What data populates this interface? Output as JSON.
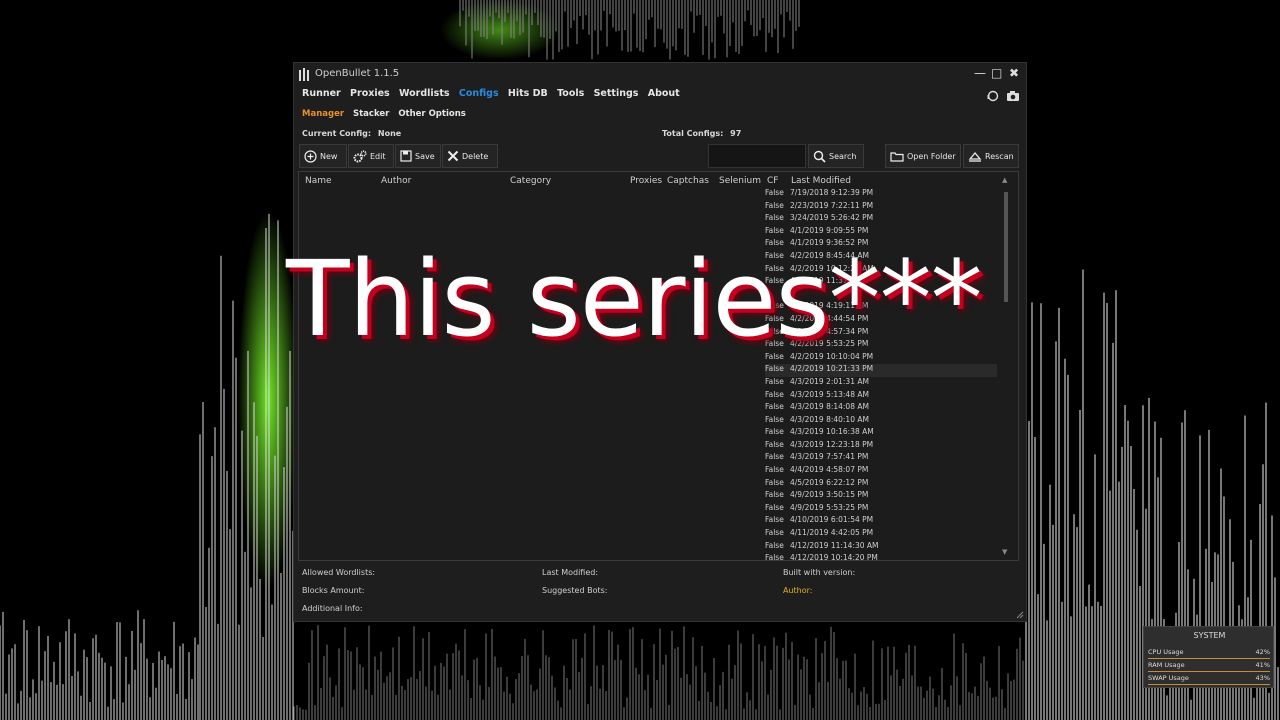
{
  "window": {
    "title": "OpenBullet 1.1.5",
    "minimize_icon": "minimize-icon",
    "maximize_icon": "maximize-icon",
    "close_icon": "close-icon"
  },
  "nav": {
    "items": [
      "Runner",
      "Proxies",
      "Wordlists",
      "Configs",
      "Hits DB",
      "Tools",
      "Settings",
      "About"
    ],
    "active": "Configs",
    "active_color": "#2a8be0"
  },
  "subnav": {
    "items": [
      "Manager",
      "Stacker",
      "Other Options"
    ],
    "active": "Manager",
    "active_color": "#e8902a"
  },
  "info": {
    "current_config_label": "Current Config:",
    "current_config_value": "None",
    "total_configs_label": "Total Configs:",
    "total_configs_value": "97"
  },
  "toolbar": {
    "new_label": "New",
    "edit_label": "Edit",
    "save_label": "Save",
    "delete_label": "Delete",
    "search_label": "Search",
    "open_folder_label": "Open Folder",
    "rescan_label": "Rescan"
  },
  "table": {
    "columns": [
      "Name",
      "Author",
      "Category",
      "Proxies",
      "Captchas",
      "Selenium",
      "CF",
      "Last Modified"
    ],
    "rows": [
      {
        "cf": "False",
        "last_modified": "7/19/2018 9:12:39 PM"
      },
      {
        "cf": "False",
        "last_modified": "2/23/2019 7:22:11 PM"
      },
      {
        "cf": "False",
        "last_modified": "3/24/2019 5:26:42 PM"
      },
      {
        "cf": "False",
        "last_modified": "4/1/2019 9:09:55 PM"
      },
      {
        "cf": "False",
        "last_modified": "4/1/2019 9:36:52 PM"
      },
      {
        "cf": "False",
        "last_modified": "4/2/2019 8:45:44 AM"
      },
      {
        "cf": "False",
        "last_modified": "4/2/2019 10:12:27 AM"
      },
      {
        "cf": "False",
        "last_modified": "4/2/2019 11:37:06"
      },
      {
        "cf": "",
        "last_modified": ""
      },
      {
        "cf": "False",
        "last_modified": "4/2/2019 4:19:11 PM"
      },
      {
        "cf": "False",
        "last_modified": "4/2/2019 4:44:54 PM"
      },
      {
        "cf": "False",
        "last_modified": "4/2/2019 4:57:34 PM"
      },
      {
        "cf": "False",
        "last_modified": "4/2/2019 5:53:25 PM"
      },
      {
        "cf": "False",
        "last_modified": "4/2/2019 10:10:04 PM"
      },
      {
        "cf": "False",
        "last_modified": "4/2/2019 10:21:33 PM"
      },
      {
        "cf": "False",
        "last_modified": "4/3/2019 2:01:31 AM"
      },
      {
        "cf": "False",
        "last_modified": "4/3/2019 5:13:48 AM"
      },
      {
        "cf": "False",
        "last_modified": "4/3/2019 8:14:08 AM"
      },
      {
        "cf": "False",
        "last_modified": "4/3/2019 8:40:10 AM"
      },
      {
        "cf": "False",
        "last_modified": "4/3/2019 10:16:38 AM"
      },
      {
        "cf": "False",
        "last_modified": "4/3/2019 12:23:18 PM"
      },
      {
        "cf": "False",
        "last_modified": "4/3/2019 7:57:41 PM"
      },
      {
        "cf": "False",
        "last_modified": "4/4/2019 4:58:07 PM"
      },
      {
        "cf": "False",
        "last_modified": "4/5/2019 6:22:12 PM"
      },
      {
        "cf": "False",
        "last_modified": "4/9/2019 3:50:15 PM"
      },
      {
        "cf": "False",
        "last_modified": "4/9/2019 5:53:25 PM"
      },
      {
        "cf": "False",
        "last_modified": "4/10/2019 6:01:54 PM"
      },
      {
        "cf": "False",
        "last_modified": "4/11/2019 4:42:05 PM"
      },
      {
        "cf": "False",
        "last_modified": "4/12/2019 11:14:30 AM"
      },
      {
        "cf": "False",
        "last_modified": "4/12/2019 10:14:20 PM"
      }
    ],
    "selected_row": 14
  },
  "details": {
    "allowed_wordlists": "Allowed Wordlists:",
    "last_modified": "Last Modified:",
    "built_with_version": "Built with version:",
    "blocks_amount": "Blocks Amount:",
    "suggested_bots": "Suggested Bots:",
    "author": "Author:",
    "additional_info": "Additional Info:"
  },
  "overlay": {
    "text": "This series***"
  },
  "system_widget": {
    "title": "SYSTEM",
    "cpu_label": "CPU Usage",
    "cpu_value": "42%",
    "ram_label": "RAM Usage",
    "ram_value": "41%",
    "swap_label": "SWAP Usage",
    "swap_value": "43%"
  }
}
